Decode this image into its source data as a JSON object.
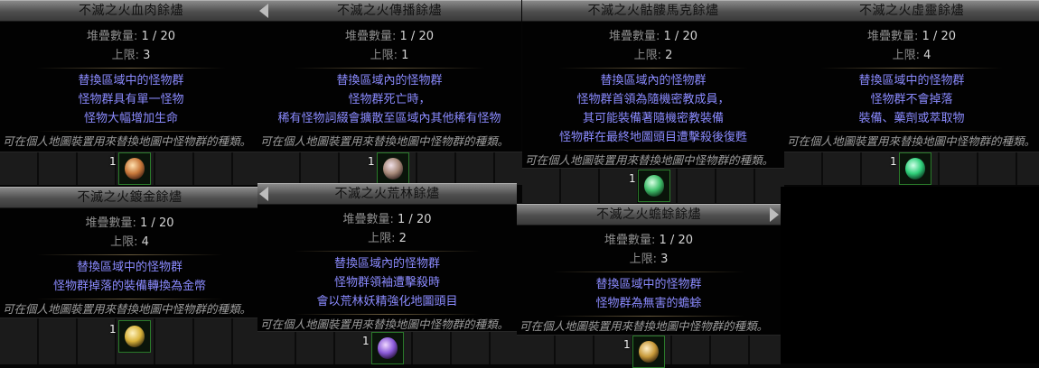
{
  "stack_label": "堆疊數量:",
  "limit_label": "上限:",
  "flavor_text": "可在個人地圖裝置用來替換地圖中怪物群的種類。",
  "cards": [
    {
      "title": "不滅之火血肉餘燼",
      "stack": "1 / 20",
      "limit": "3",
      "mods": [
        "替換區域中的怪物群",
        "怪物群具有單一怪物",
        "怪物大幅增加生命"
      ],
      "stack_count": "1",
      "orb_color": "#c8783a"
    },
    {
      "title": "不滅之火傳播餘燼",
      "stack": "1 / 20",
      "limit": "1",
      "mods": [
        "替換區域內的怪物群",
        "怪物群死亡時，",
        "稀有怪物詞綴會擴散至區域內其他稀有怪物"
      ],
      "stack_count": "1",
      "orb_color": "#a88a7a"
    },
    {
      "title": "不滅之火骷髏馬克餘燼",
      "stack": "1 / 20",
      "limit": "2",
      "mods": [
        "替換區域內的怪物群",
        "怪物群首領為隨機密教成員，",
        "其可能裝備著隨機密教裝備",
        "怪物群在最終地圖頭目遭擊殺後復甦"
      ],
      "stack_count": "1",
      "orb_color": "#3fbf6a"
    },
    {
      "title": "不滅之火虛靈餘燼",
      "stack": "1 / 20",
      "limit": "4",
      "mods": [
        "替換區域中的怪物群",
        "怪物群不會掉落",
        "裝備、藥劑或萃取物"
      ],
      "stack_count": "1",
      "orb_color": "#2fd07a"
    },
    {
      "title": "不滅之火鍍金餘燼",
      "stack": "1 / 20",
      "limit": "4",
      "mods": [
        "替換區域中的怪物群",
        "怪物群掉落的裝備轉換為金幣"
      ],
      "stack_count": "1",
      "orb_color": "#d8b23a"
    },
    {
      "title": "不滅之火荒林餘燼",
      "stack": "1 / 20",
      "limit": "2",
      "mods": [
        "替換區域內的怪物群",
        "怪物群領袖遭擊殺時",
        "會以荒林妖精強化地圖頭目"
      ],
      "stack_count": "1",
      "orb_color": "#8a5ad8"
    },
    {
      "title": "不滅之火蟾蜍餘燼",
      "stack": "1 / 20",
      "limit": "3",
      "mods": [
        "替換區域中的怪物群",
        "怪物群為無害的蟾蜍"
      ],
      "stack_count": "1",
      "orb_color": "#c89a3a"
    }
  ]
}
